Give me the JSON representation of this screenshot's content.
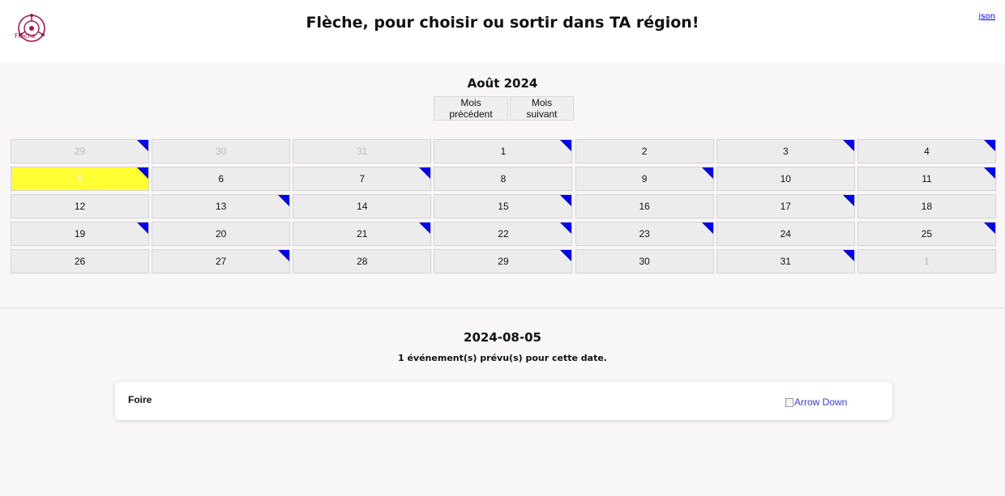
{
  "header": {
    "logo_text": "Flèche",
    "title": "Flèche, pour choisir ou sortir dans TA région!",
    "json_link": "json"
  },
  "calendar": {
    "month_title": "Août 2024",
    "prev_label": "Mois précédent",
    "next_label": "Mois suivant",
    "days": [
      {
        "label": "29",
        "other": true,
        "event": true
      },
      {
        "label": "30",
        "other": true,
        "event": false
      },
      {
        "label": "31",
        "other": true,
        "event": false
      },
      {
        "label": "1",
        "other": false,
        "event": true
      },
      {
        "label": "2",
        "other": false,
        "event": false
      },
      {
        "label": "3",
        "other": false,
        "event": true
      },
      {
        "label": "4",
        "other": false,
        "event": true
      },
      {
        "label": "5",
        "other": false,
        "event": true,
        "today": true
      },
      {
        "label": "6",
        "other": false,
        "event": false
      },
      {
        "label": "7",
        "other": false,
        "event": true
      },
      {
        "label": "8",
        "other": false,
        "event": false
      },
      {
        "label": "9",
        "other": false,
        "event": true
      },
      {
        "label": "10",
        "other": false,
        "event": false
      },
      {
        "label": "11",
        "other": false,
        "event": true
      },
      {
        "label": "12",
        "other": false,
        "event": false
      },
      {
        "label": "13",
        "other": false,
        "event": true
      },
      {
        "label": "14",
        "other": false,
        "event": false
      },
      {
        "label": "15",
        "other": false,
        "event": true
      },
      {
        "label": "16",
        "other": false,
        "event": false
      },
      {
        "label": "17",
        "other": false,
        "event": true
      },
      {
        "label": "18",
        "other": false,
        "event": false
      },
      {
        "label": "19",
        "other": false,
        "event": true
      },
      {
        "label": "20",
        "other": false,
        "event": false
      },
      {
        "label": "21",
        "other": false,
        "event": true
      },
      {
        "label": "22",
        "other": false,
        "event": true
      },
      {
        "label": "23",
        "other": false,
        "event": true
      },
      {
        "label": "24",
        "other": false,
        "event": false
      },
      {
        "label": "25",
        "other": false,
        "event": true
      },
      {
        "label": "26",
        "other": false,
        "event": false
      },
      {
        "label": "27",
        "other": false,
        "event": true
      },
      {
        "label": "28",
        "other": false,
        "event": false
      },
      {
        "label": "29",
        "other": false,
        "event": true
      },
      {
        "label": "30",
        "other": false,
        "event": false
      },
      {
        "label": "31",
        "other": false,
        "event": true
      },
      {
        "label": "1",
        "other": true,
        "event": false
      }
    ]
  },
  "selection": {
    "date": "2024-08-05",
    "count_text": "1 événement(s) prévu(s) pour cette date.",
    "events": [
      {
        "name": "Foire",
        "arrow_alt": "Arrow Down",
        "arrow_icon": "arrow-down-icon"
      }
    ]
  },
  "colors": {
    "today": "#ffff33",
    "event_marker": "#0000f0",
    "link": "#0000ee",
    "logo": "#a0184a"
  }
}
